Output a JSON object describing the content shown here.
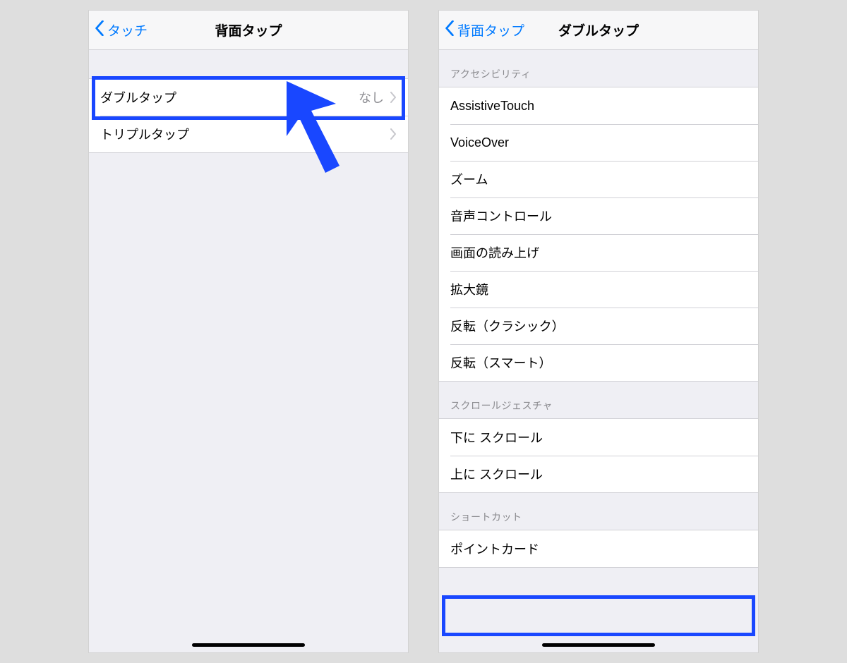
{
  "colors": {
    "accent": "#007aff",
    "highlight": "#1947ff"
  },
  "left": {
    "back": "タッチ",
    "title": "背面タップ",
    "rows": [
      {
        "label": "ダブルタップ",
        "value": "なし"
      },
      {
        "label": "トリプルタップ",
        "value": ""
      }
    ]
  },
  "right": {
    "back": "背面タップ",
    "title": "ダブルタップ",
    "sections": [
      {
        "header": "アクセシビリティ",
        "items": [
          "AssistiveTouch",
          "VoiceOver",
          "ズーム",
          "音声コントロール",
          "画面の読み上げ",
          "拡大鏡",
          "反転（クラシック）",
          "反転（スマート）"
        ]
      },
      {
        "header": "スクロールジェスチャ",
        "items": [
          "下に スクロール",
          "上に スクロール"
        ]
      },
      {
        "header": "ショートカット",
        "items": [
          "ポイントカード"
        ]
      }
    ]
  }
}
